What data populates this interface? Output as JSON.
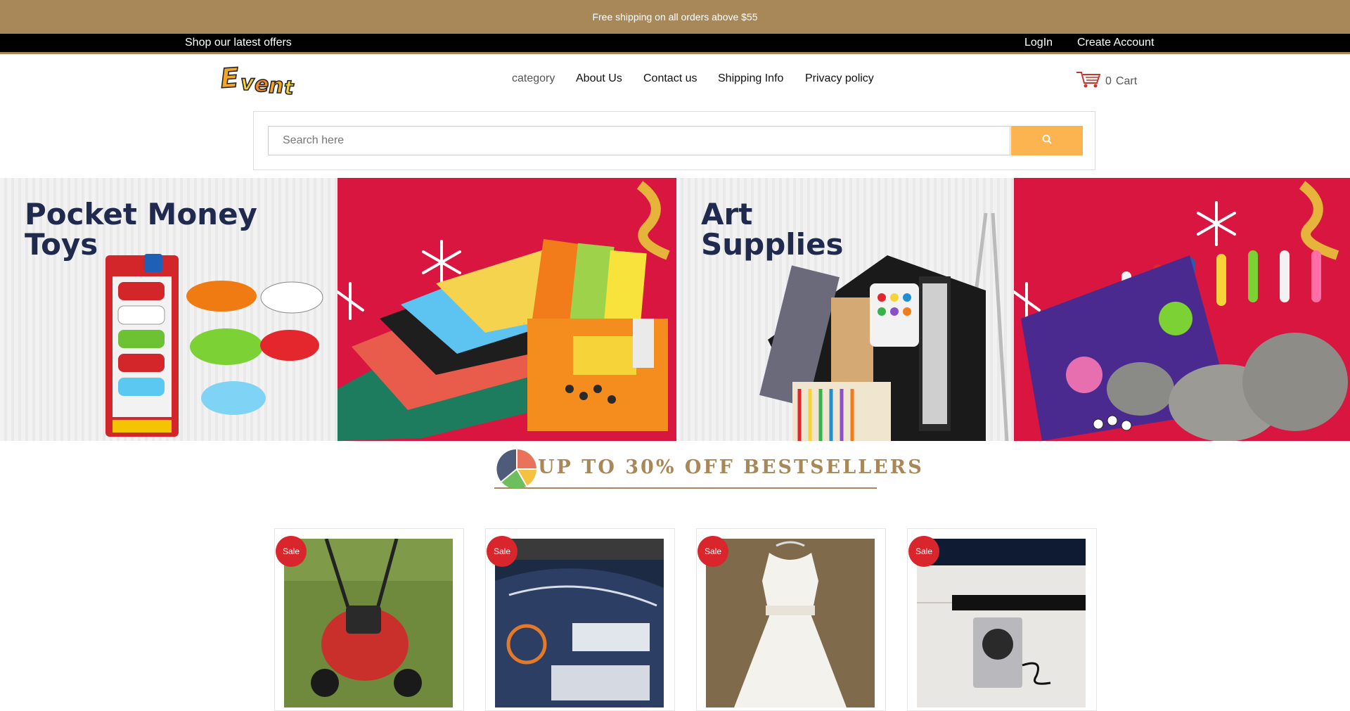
{
  "announcement": "Free shipping on all orders above $55",
  "topbar": {
    "offers": "Shop our latest offers",
    "login": "LogIn",
    "create_account": "Create Account"
  },
  "header": {
    "logo_text": "Event",
    "nav": [
      "category",
      "About Us",
      "Contact us",
      "Shipping Info",
      "Privacy policy"
    ],
    "cart_count": "0",
    "cart_label": "Cart"
  },
  "search": {
    "placeholder": "Search here"
  },
  "banners": [
    {
      "title_line1": "Pocket Money",
      "title_line2": "Toys"
    },
    {
      "title_line1": "Art",
      "title_line2": "Supplies"
    }
  ],
  "section_heading": "UP TO 30% OFF BESTSELLERS",
  "products": [
    {
      "badge": "Sale",
      "image": "lawn-mower"
    },
    {
      "badge": "Sale",
      "image": "wire-roll"
    },
    {
      "badge": "Sale",
      "image": "white-dress"
    },
    {
      "badge": "Sale",
      "image": "speaker"
    }
  ],
  "colors": {
    "accent": "#a88858",
    "search_button": "#fbb450",
    "sale_badge": "#d9262c",
    "banner_red": "#d8163f",
    "banner_title": "#1f2a4e"
  }
}
